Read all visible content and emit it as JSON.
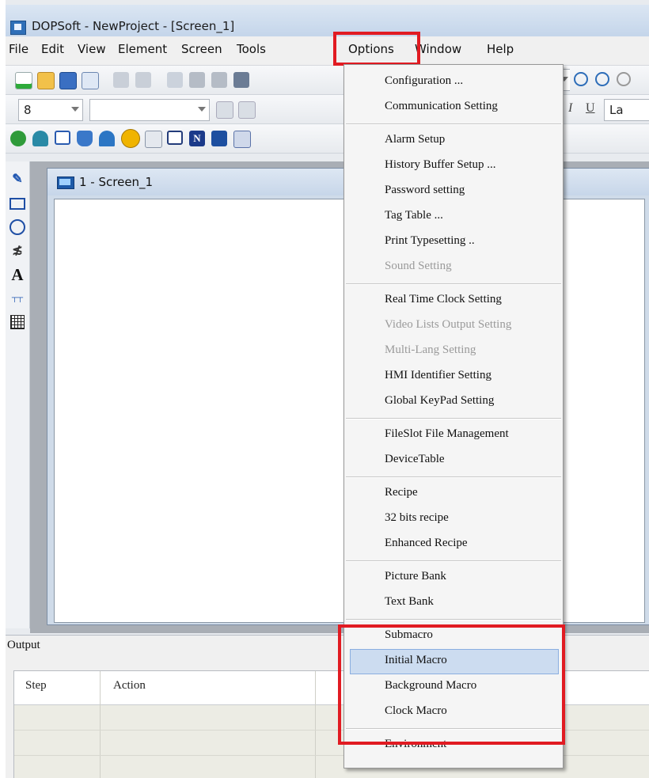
{
  "window": {
    "title": "DOPSoft - NewProject - [Screen_1]"
  },
  "menubar": {
    "items": [
      "File",
      "Edit",
      "View",
      "Element",
      "Screen",
      "Tools",
      "Options",
      "Window",
      "Help"
    ],
    "active": "Options"
  },
  "toolbar": {
    "font_size_value": "8",
    "partial_text_right": "La",
    "italic_label": "I",
    "underline_label": "U",
    "shape_label_text": "A"
  },
  "child_window": {
    "title": "1 - Screen_1"
  },
  "output": {
    "title": "Output",
    "columns": [
      "Step",
      "Action"
    ]
  },
  "options_menu": {
    "groups": [
      [
        {
          "label": "Configuration ...",
          "enabled": true
        },
        {
          "label": "Communication Setting",
          "enabled": true
        }
      ],
      [
        {
          "label": "Alarm Setup",
          "enabled": true
        },
        {
          "label": "History Buffer Setup ...",
          "enabled": true
        },
        {
          "label": "Password setting",
          "enabled": true
        },
        {
          "label": "Tag Table ...",
          "enabled": true
        },
        {
          "label": "Print Typesetting ..",
          "enabled": true
        },
        {
          "label": "Sound Setting",
          "enabled": false
        }
      ],
      [
        {
          "label": "Real Time Clock Setting",
          "enabled": true
        },
        {
          "label": "Video Lists Output Setting",
          "enabled": false
        },
        {
          "label": "Multi-Lang Setting",
          "enabled": false
        },
        {
          "label": "HMI Identifier Setting",
          "enabled": true
        },
        {
          "label": "Global KeyPad Setting",
          "enabled": true
        }
      ],
      [
        {
          "label": "FileSlot File Management",
          "enabled": true
        },
        {
          "label": "DeviceTable",
          "enabled": true
        }
      ],
      [
        {
          "label": "Recipe",
          "enabled": true
        },
        {
          "label": "32 bits recipe",
          "enabled": true
        },
        {
          "label": "Enhanced Recipe",
          "enabled": true
        }
      ],
      [
        {
          "label": "Picture Bank",
          "enabled": true
        },
        {
          "label": "Text Bank",
          "enabled": true
        }
      ],
      [
        {
          "label": "Submacro",
          "enabled": true
        },
        {
          "label": "Initial Macro",
          "enabled": true,
          "hovered": true
        },
        {
          "label": "Background Macro",
          "enabled": true
        },
        {
          "label": "Clock Macro",
          "enabled": true
        }
      ],
      [
        {
          "label": "Environment",
          "enabled": true
        }
      ]
    ]
  },
  "colors": {
    "highlight_red": "#e11b22",
    "hover_blue": "#ccdcf0"
  }
}
